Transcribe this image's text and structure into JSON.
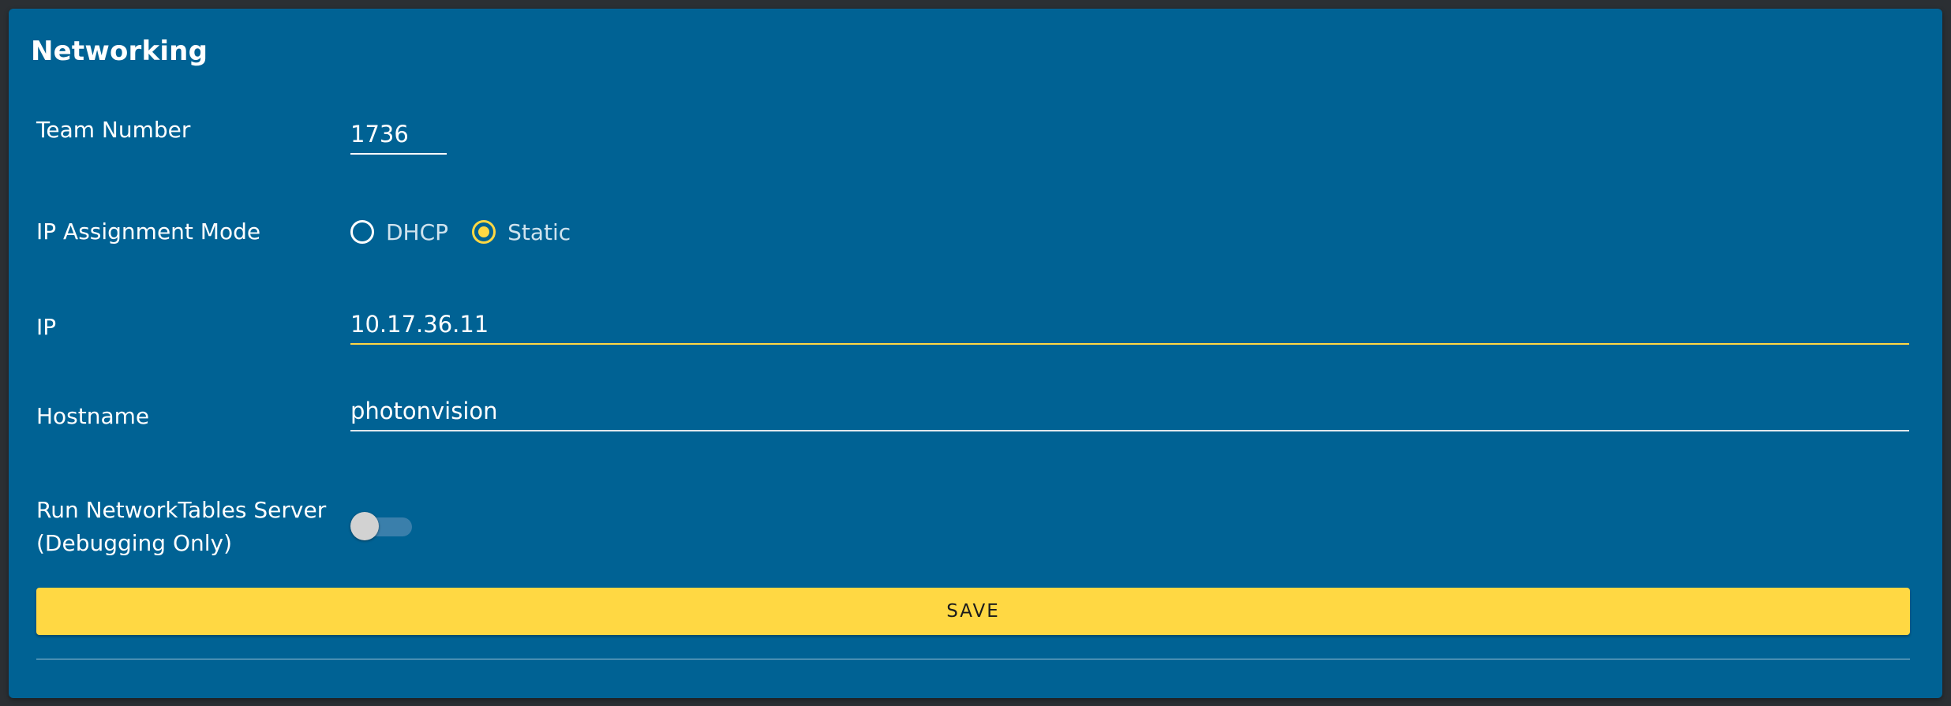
{
  "section": {
    "title": "Networking"
  },
  "team_number": {
    "label": "Team Number",
    "value": "1736"
  },
  "ip_mode": {
    "label": "IP Assignment Mode",
    "options": [
      {
        "label": "DHCP",
        "selected": false
      },
      {
        "label": "Static",
        "selected": true
      }
    ]
  },
  "ip": {
    "label": "IP",
    "value": "10.17.36.11"
  },
  "hostname": {
    "label": "Hostname",
    "value": "photonvision"
  },
  "nt_server": {
    "label_line1": "Run NetworkTables Server",
    "label_line2": "(Debugging Only)",
    "enabled": false
  },
  "actions": {
    "save_label": "SAVE"
  },
  "colors": {
    "background": "#006294",
    "accent": "#ffd843",
    "page": "#2b2f33"
  }
}
